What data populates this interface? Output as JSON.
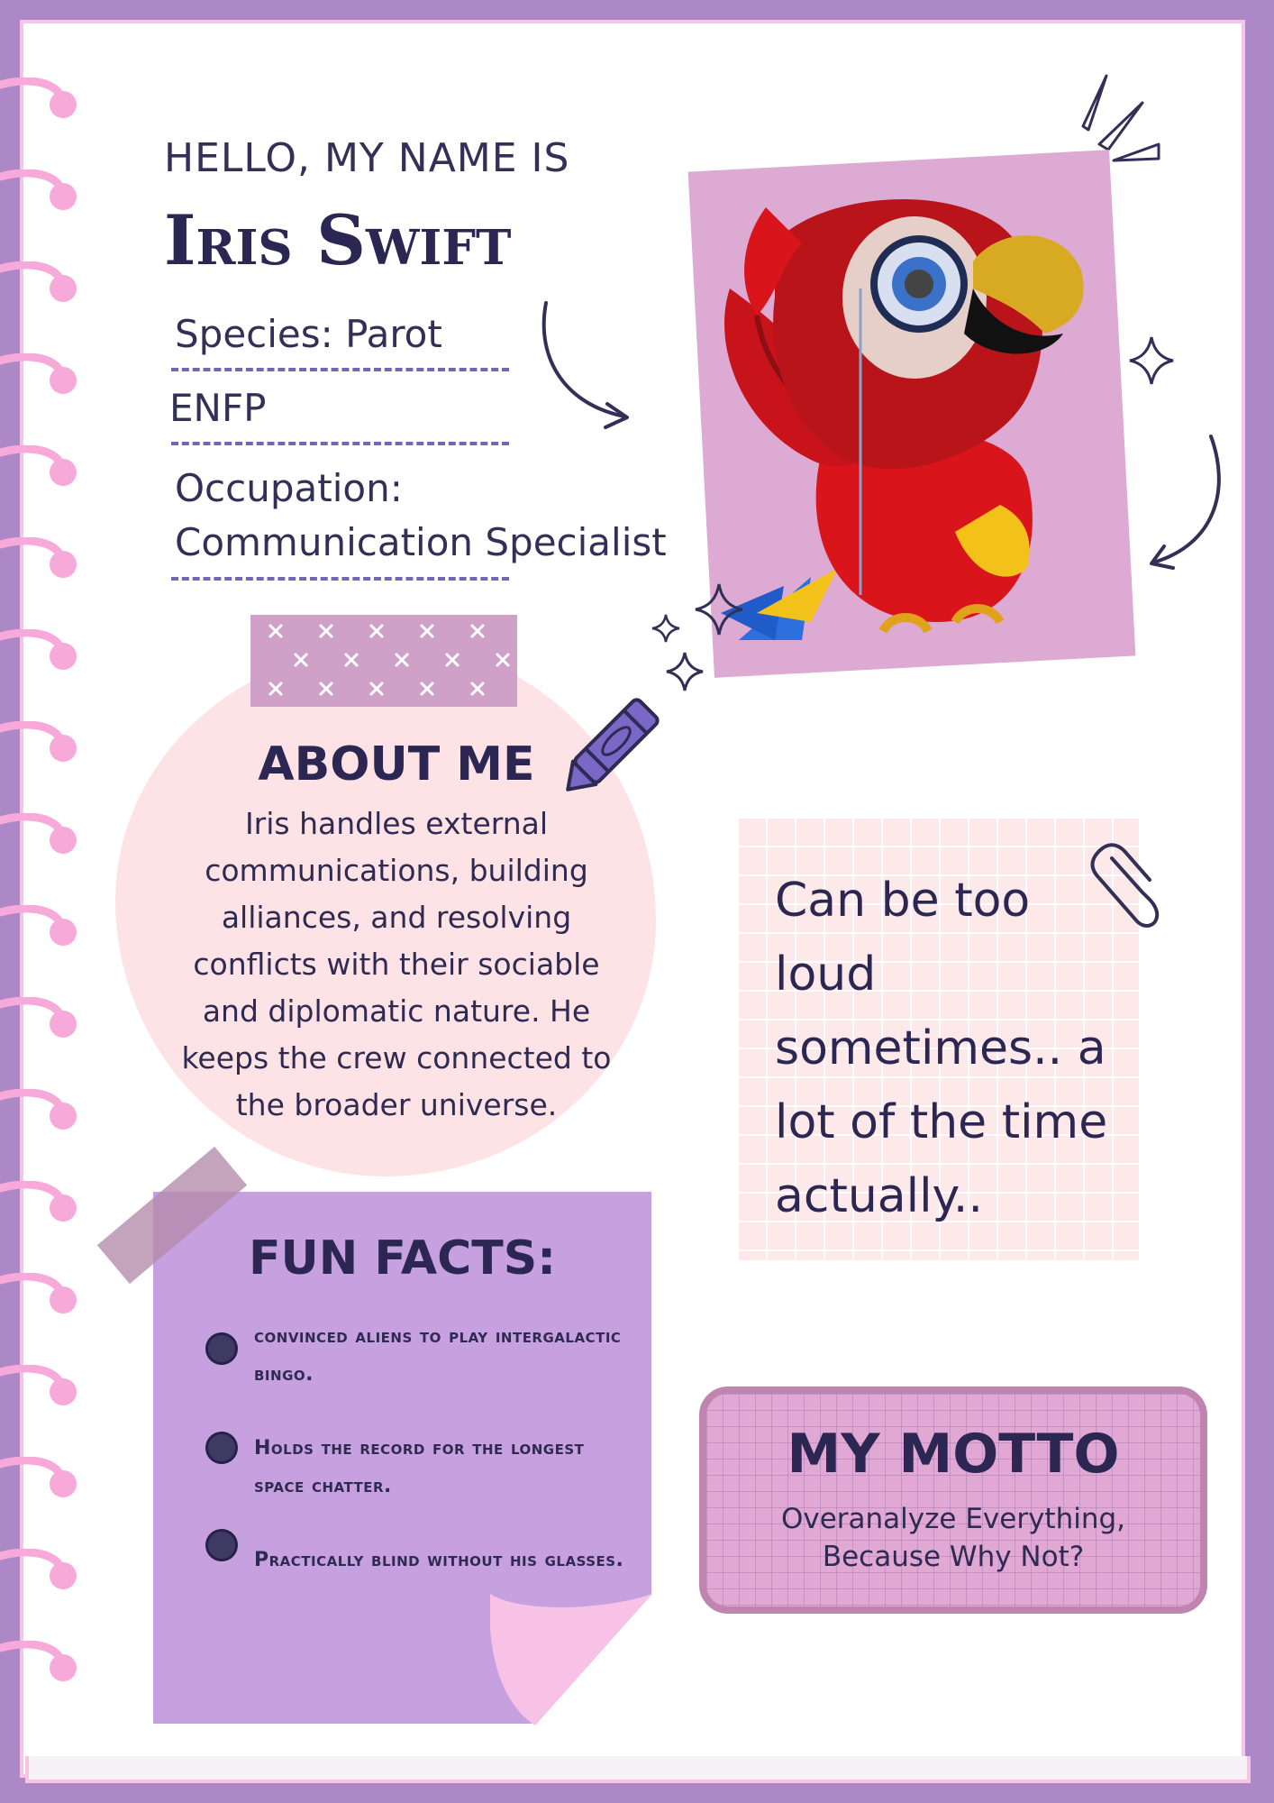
{
  "header": {
    "greeting": "HELLO, MY NAME IS",
    "name": "Iris Swift"
  },
  "profile": {
    "species": "Species: Parot",
    "personality": "ENFP",
    "occupation_label": "Occupation:",
    "occupation_value": "Communication Specialist"
  },
  "about": {
    "title": "ABOUT ME",
    "text": "Iris handles external communications, building alliances, and resolving conflicts with their sociable and diplomatic nature. He keeps the crew connected to the broader universe."
  },
  "note": {
    "text": "Can be too loud sometimes.. a lot of the time actually.."
  },
  "fun_facts": {
    "title": "FUN FACTS:",
    "items": [
      "convinced aliens to play intergalactic bingo.",
      "Holds the record for the longest space chatter.",
      "Practically blind without his glasses."
    ]
  },
  "motto": {
    "title": "MY MOTTO",
    "line1": "Overanalyze Everything,",
    "line2": "Because Why Not?"
  },
  "colors": {
    "border": "#ac88c6",
    "ink": "#2b2752",
    "pink_note": "#fde8ea",
    "facts_bg": "#c7a1df",
    "motto_bg": "#e0a8d2"
  }
}
